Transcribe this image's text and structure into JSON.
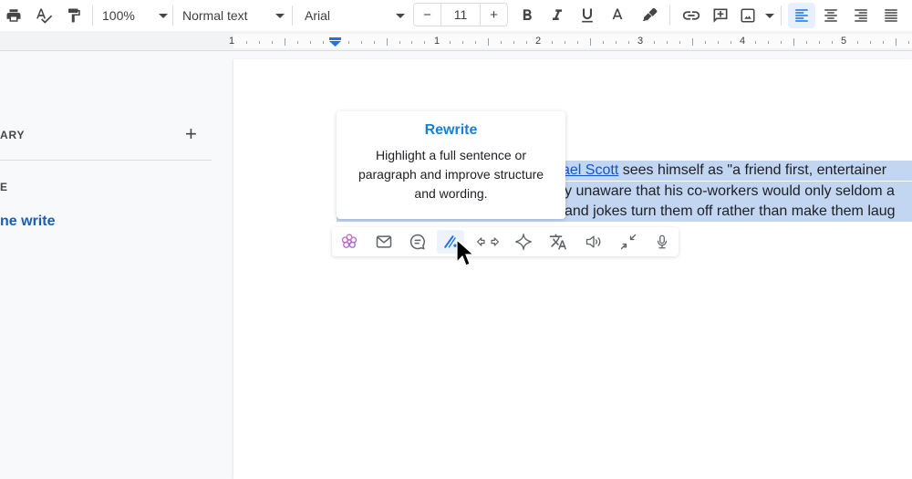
{
  "toolbar": {
    "zoom": "100%",
    "paragraph_style": "Normal text",
    "font": "Arial",
    "font_size": "11",
    "decrease_symbol": "−",
    "increase_symbol": "+",
    "icons": [
      "print-icon",
      "spellcheck-icon",
      "paint-format-icon",
      "bold-icon",
      "italic-icon",
      "underline-icon",
      "text-color-icon",
      "highlight-icon",
      "link-icon",
      "add-comment-icon",
      "insert-image-icon",
      "align-left-icon",
      "align-center-icon",
      "align-right-icon",
      "justify-icon"
    ],
    "active_alignment": "left",
    "accent": "#1a73e8"
  },
  "ruler": {
    "numbers": [
      "1",
      "1",
      "2",
      "3",
      "4",
      "5"
    ]
  },
  "sidebar": {
    "section_1": "ARY",
    "add_label": "+",
    "section_2": "E",
    "item": "ne write"
  },
  "document": {
    "lines": [
      {
        "link": "ael Scott",
        "text": " sees himself as \"a friend first, entertainer"
      },
      {
        "link": "",
        "text": "y unaware that his co-workers would only seldom a"
      },
      {
        "link": "",
        "text": "and jokes turn them off rather than make them laug"
      }
    ],
    "selection_color": "#c2d6f2"
  },
  "tooltip": {
    "title": "Rewrite",
    "body": "Highlight a full sentence or paragraph and improve structure and wording."
  },
  "ai_toolbar": {
    "buttons": [
      {
        "name": "flower-logo-icon"
      },
      {
        "name": "email-icon"
      },
      {
        "name": "chat-bubble-icon"
      },
      {
        "name": "rewrite-pen-icon",
        "active": true
      },
      {
        "name": "expand-shorten-icon"
      },
      {
        "name": "sparkle-icon"
      },
      {
        "name": "translate-icon"
      },
      {
        "name": "speaker-icon"
      },
      {
        "name": "collapse-arrows-icon"
      },
      {
        "name": "microphone-icon"
      }
    ]
  }
}
